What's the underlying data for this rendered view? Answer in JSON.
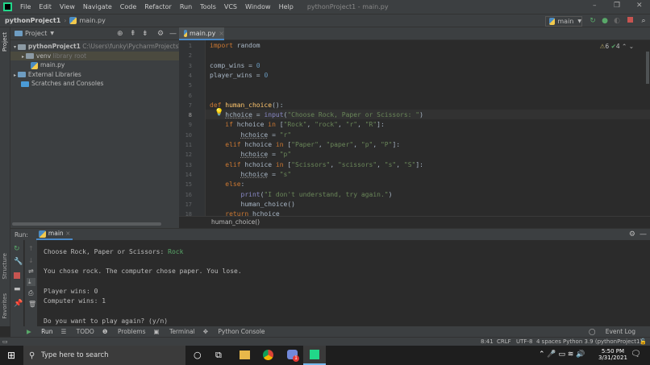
{
  "menubar": {
    "items": [
      "File",
      "Edit",
      "View",
      "Navigate",
      "Code",
      "Refactor",
      "Run",
      "Tools",
      "VCS",
      "Window",
      "Help"
    ],
    "title": "pythonProject1 - main.py"
  },
  "navbar": {
    "project": "pythonProject1",
    "file": "main.py",
    "run_config": "main"
  },
  "project_panel": {
    "title": "Project",
    "root": "pythonProject1",
    "root_path": "C:\\Users\\funky\\PycharmProjects\\pythonP",
    "venv": "venv",
    "venv_note": "library root",
    "main": "main.py",
    "ext": "External Libraries",
    "scratch": "Scratches and Consoles"
  },
  "side_labels": {
    "project": "Project",
    "structure": "Structure",
    "favorites": "Favorites"
  },
  "editor": {
    "tab": "main.py",
    "warnings": "6",
    "checks": "4",
    "breadcrumb": "human_choice()",
    "lines": [
      [
        [
          "import",
          "kw"
        ],
        [
          " random",
          ""
        ]
      ],
      [],
      [
        [
          "comp_wins = ",
          ""
        ],
        [
          "0",
          "num"
        ]
      ],
      [
        [
          "player_wins = ",
          ""
        ],
        [
          "0",
          "num"
        ]
      ],
      [],
      [],
      [
        [
          "def ",
          "kw"
        ],
        [
          "human_choice",
          "fn"
        ],
        [
          "():",
          ""
        ]
      ],
      [
        [
          "    ",
          ""
        ],
        [
          "hchoice",
          "ul"
        ],
        [
          " = ",
          ""
        ],
        [
          "input",
          "bi"
        ],
        [
          "(",
          ""
        ],
        [
          "\"Choose Rock, Paper or Scissors: \"",
          "str"
        ],
        [
          ")",
          ""
        ]
      ],
      [
        [
          "    ",
          ""
        ],
        [
          "if ",
          "kw"
        ],
        [
          "hchoice ",
          ""
        ],
        [
          "in ",
          "kw"
        ],
        [
          "[",
          ""
        ],
        [
          "\"Rock\"",
          "str"
        ],
        [
          ", ",
          ""
        ],
        [
          "\"rock\"",
          "str"
        ],
        [
          ", ",
          ""
        ],
        [
          "\"r\"",
          "str"
        ],
        [
          ", ",
          ""
        ],
        [
          "\"R\"",
          "str"
        ],
        [
          "]:",
          ""
        ]
      ],
      [
        [
          "        ",
          ""
        ],
        [
          "hchoice",
          "ul"
        ],
        [
          " = ",
          ""
        ],
        [
          "\"r\"",
          "str"
        ]
      ],
      [
        [
          "    ",
          ""
        ],
        [
          "elif ",
          "kw"
        ],
        [
          "hchoice ",
          ""
        ],
        [
          "in ",
          "kw"
        ],
        [
          "[",
          ""
        ],
        [
          "\"Paper\"",
          "str"
        ],
        [
          ", ",
          ""
        ],
        [
          "\"paper\"",
          "str"
        ],
        [
          ", ",
          ""
        ],
        [
          "\"p\"",
          "str"
        ],
        [
          ", ",
          ""
        ],
        [
          "\"P\"",
          "str"
        ],
        [
          "]:",
          ""
        ]
      ],
      [
        [
          "        ",
          ""
        ],
        [
          "hchoice",
          "ul"
        ],
        [
          " = ",
          ""
        ],
        [
          "\"p\"",
          "str"
        ]
      ],
      [
        [
          "    ",
          ""
        ],
        [
          "elif ",
          "kw"
        ],
        [
          "hchoice ",
          ""
        ],
        [
          "in ",
          "kw"
        ],
        [
          "[",
          ""
        ],
        [
          "\"Scissors\"",
          "str"
        ],
        [
          ", ",
          ""
        ],
        [
          "\"scissors\"",
          "str"
        ],
        [
          ", ",
          ""
        ],
        [
          "\"s\"",
          "str"
        ],
        [
          ", ",
          ""
        ],
        [
          "\"S\"",
          "str"
        ],
        [
          "]:",
          ""
        ]
      ],
      [
        [
          "        ",
          ""
        ],
        [
          "hchoice",
          "ul"
        ],
        [
          " = ",
          ""
        ],
        [
          "\"s\"",
          "str"
        ]
      ],
      [
        [
          "    ",
          ""
        ],
        [
          "else",
          "kw"
        ],
        [
          ":",
          ""
        ]
      ],
      [
        [
          "        ",
          ""
        ],
        [
          "print",
          "bi"
        ],
        [
          "(",
          ""
        ],
        [
          "\"I don't understand, try again.\"",
          "str"
        ],
        [
          ")",
          ""
        ]
      ],
      [
        [
          "        human_choice()",
          ""
        ]
      ],
      [
        [
          "    ",
          ""
        ],
        [
          "return ",
          "kw"
        ],
        [
          "hchoice",
          ""
        ]
      ]
    ]
  },
  "run": {
    "label": "Run:",
    "tab": "main",
    "prompt": "Choose Rock, Paper or Scissors: ",
    "input": "Rock",
    "result": "You chose rock. The computer chose paper. You lose.",
    "player": "Player wins: 0",
    "computer": "Computer wins: 1",
    "again": "Do you want to play again? (y/n)"
  },
  "bottom_tabs": [
    "Run",
    "TODO",
    "Problems",
    "Terminal",
    "Python Console"
  ],
  "status": {
    "event_log": "Event Log",
    "pos": "8:41",
    "eol": "CRLF",
    "enc": "UTF-8",
    "indent": "4 spaces",
    "interp": "Python 3.9 (pythonProject1)"
  },
  "taskbar": {
    "search": "Type here to search",
    "time": "5:50 PM",
    "date": "3/31/2021",
    "badge": "1"
  }
}
